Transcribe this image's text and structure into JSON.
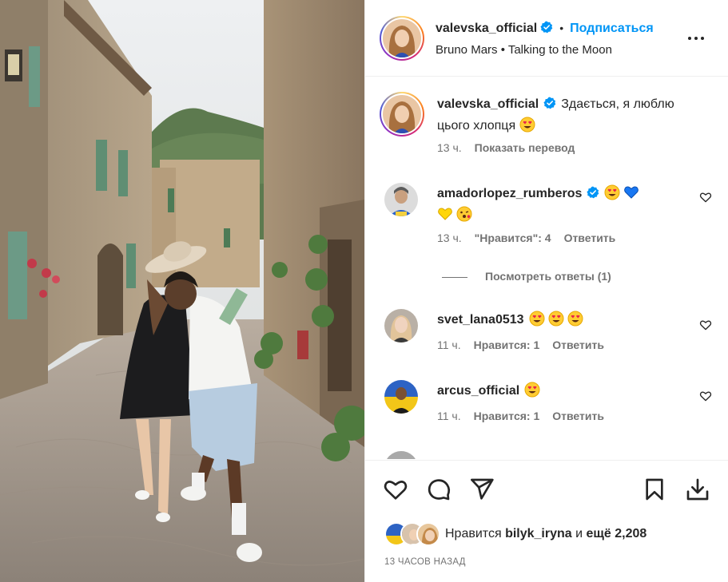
{
  "post": {
    "author": "valevska_official",
    "follow_label": "Подписаться",
    "dot": "•",
    "music": "Bruno Mars • Talking to the Moon",
    "more_label": "•••"
  },
  "caption": {
    "user": "valevska_official",
    "text": "Здається, я люблю цього хлопця",
    "time": "13 ч.",
    "translate": "Показать перевод"
  },
  "comments": [
    {
      "user": "amadorlopez_rumberos",
      "text": "",
      "emojis": [
        "heart-eyes",
        "blue-heart",
        "yellow-heart",
        "kiss"
      ],
      "time": "13 ч.",
      "likes": "\"Нравится\": 4",
      "reply": "Ответить",
      "verified": true
    },
    {
      "user": "svet_lana0513",
      "text": "",
      "emojis": [
        "heart-eyes",
        "heart-eyes",
        "heart-eyes"
      ],
      "time": "11 ч.",
      "likes": "Нравится: 1",
      "reply": "Ответить",
      "verified": false
    },
    {
      "user": "arcus_official",
      "text": "",
      "emojis": [
        "heart-eyes"
      ],
      "time": "11 ч.",
      "likes": "Нравится: 1",
      "reply": "Ответить",
      "verified": false
    }
  ],
  "view_replies": "Посмотреть ответы (1)",
  "likes": {
    "prefix": "Нравится",
    "user": "bilyk_iryna",
    "middle": "и",
    "rest": "ещё 2,208"
  },
  "timestamp": "13 ЧАСОВ НАЗАД",
  "colors": {
    "link": "#0095f6",
    "muted": "#737373",
    "text": "#262626",
    "verified": "#0095f6"
  },
  "icons": [
    "verified-icon",
    "more-icon",
    "heart-icon",
    "comment-icon",
    "share-icon",
    "save-icon",
    "download-icon"
  ]
}
